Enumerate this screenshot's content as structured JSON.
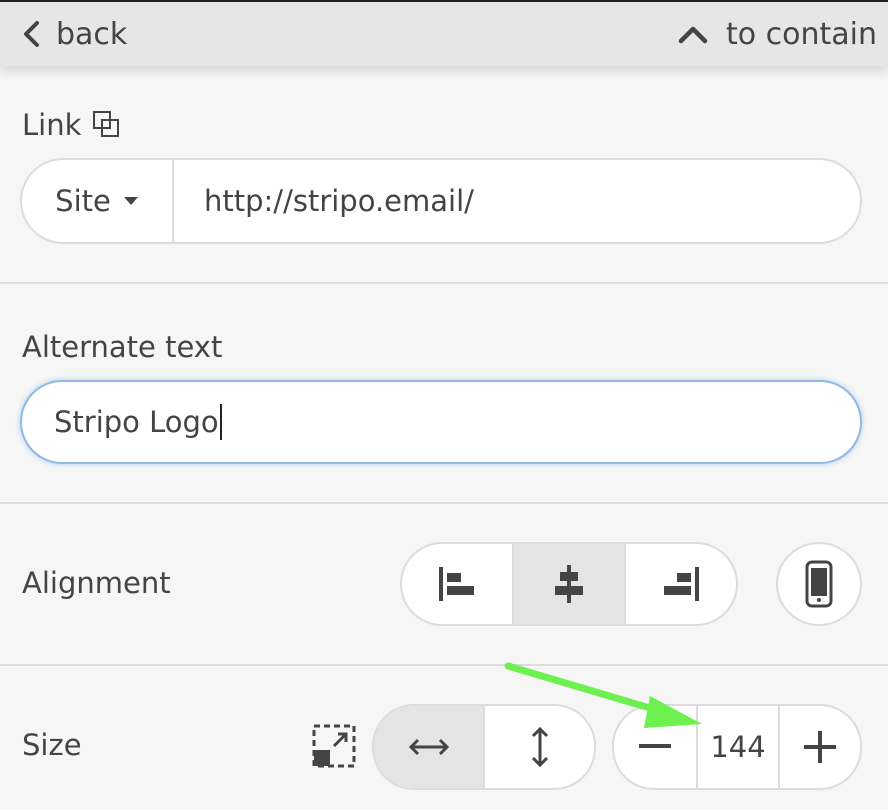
{
  "topbar": {
    "back_label": "back",
    "container_label": "to contain"
  },
  "link": {
    "label": "Link",
    "type_value": "Site",
    "url_value": "http://stripo.email/"
  },
  "alt_text": {
    "label": "Alternate text",
    "value": "Stripo Logo"
  },
  "alignment": {
    "label": "Alignment",
    "options": [
      "align-left-icon",
      "align-center-icon",
      "align-right-icon"
    ],
    "selected": "align-center-icon"
  },
  "size": {
    "label": "Size",
    "mode_selected": "width",
    "value": "144"
  },
  "colors": {
    "annotation_arrow": "#6ef050",
    "focus_border": "#8fb9e6"
  }
}
